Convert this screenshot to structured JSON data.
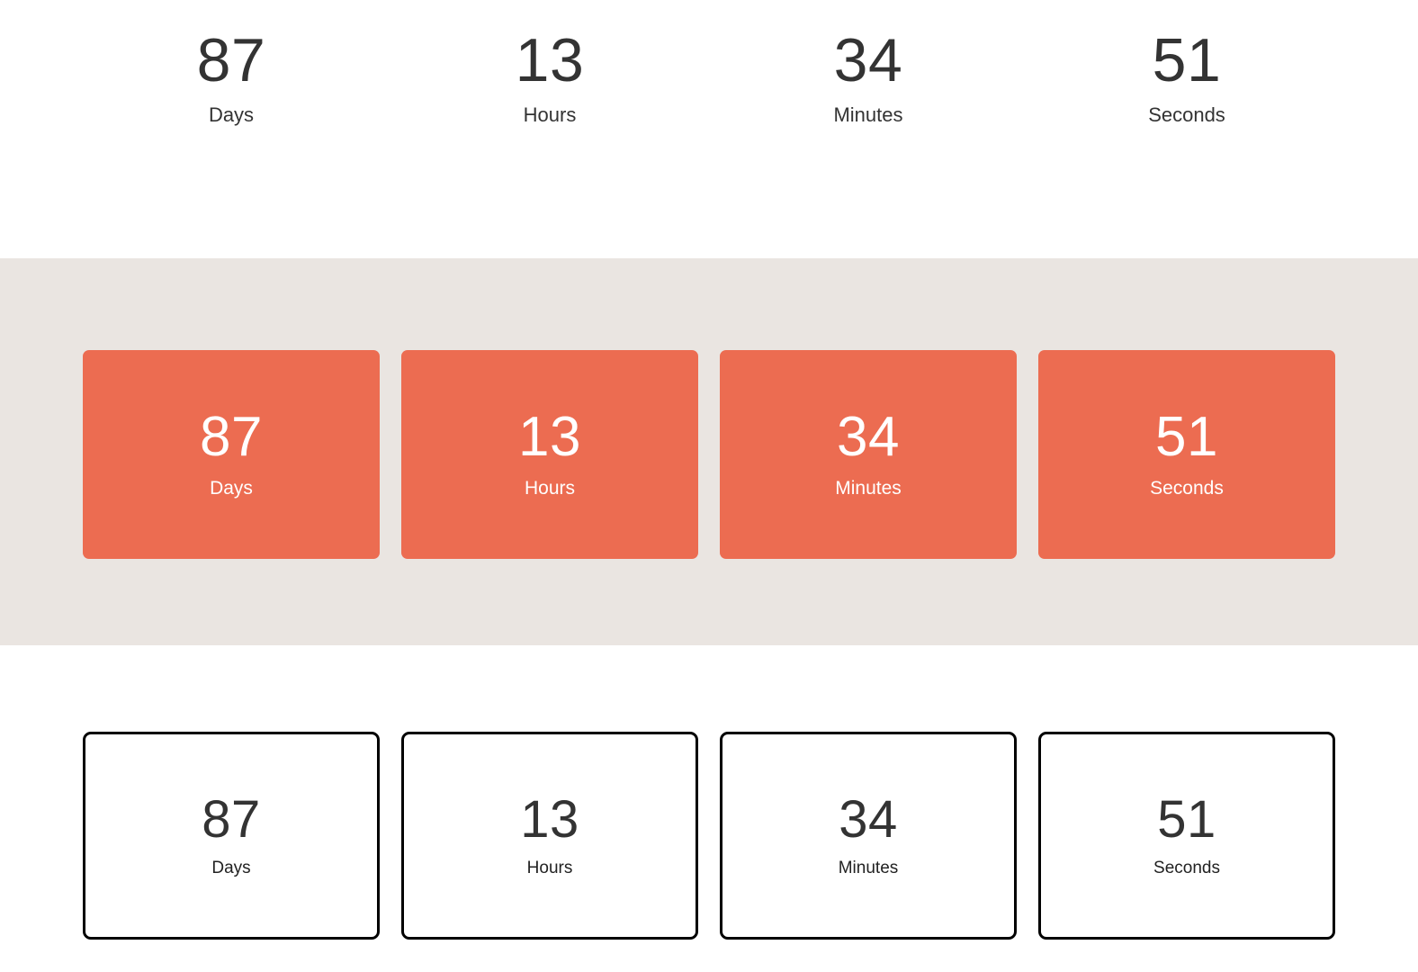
{
  "colors": {
    "accent_orange": "#ec6c51",
    "band_beige": "#eae5e1",
    "text_dark": "#333333",
    "text_light": "#ffffff",
    "outline_black": "#000000",
    "page_background": "#ffffff"
  },
  "countdown": {
    "days": "87",
    "hours": "13",
    "minutes": "34",
    "seconds": "51",
    "labels": {
      "days": "Days",
      "hours": "Hours",
      "minutes": "Minutes",
      "seconds": "Seconds"
    }
  },
  "variants": [
    {
      "style": "plain-text",
      "units": [
        {
          "value": "87",
          "label": "Days"
        },
        {
          "value": "13",
          "label": "Hours"
        },
        {
          "value": "34",
          "label": "Minutes"
        },
        {
          "value": "51",
          "label": "Seconds"
        }
      ]
    },
    {
      "style": "filled-card",
      "units": [
        {
          "value": "87",
          "label": "Days"
        },
        {
          "value": "13",
          "label": "Hours"
        },
        {
          "value": "34",
          "label": "Minutes"
        },
        {
          "value": "51",
          "label": "Seconds"
        }
      ]
    },
    {
      "style": "outlined-card",
      "units": [
        {
          "value": "87",
          "label": "Days"
        },
        {
          "value": "13",
          "label": "Hours"
        },
        {
          "value": "34",
          "label": "Minutes"
        },
        {
          "value": "51",
          "label": "Seconds"
        }
      ]
    }
  ]
}
